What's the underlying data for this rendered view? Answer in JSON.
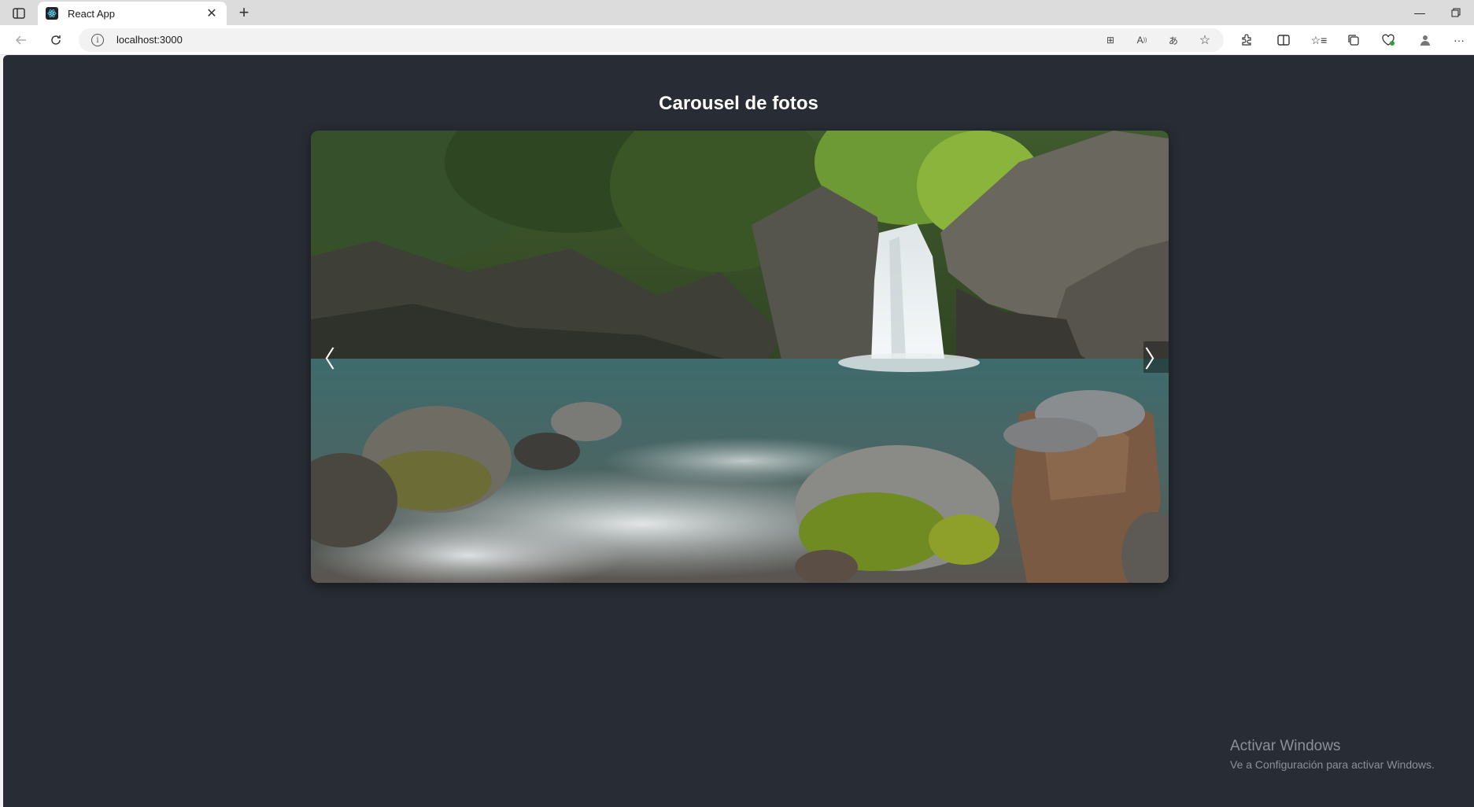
{
  "browser": {
    "tab": {
      "title": "React App"
    },
    "address": {
      "url": "localhost:3000"
    }
  },
  "page": {
    "title": "Carousel de fotos",
    "carousel": {
      "prev_label": "〈",
      "next_label": "〉"
    }
  },
  "watermark": {
    "line1": "Activar Windows",
    "line2": "Ve a Configuración para activar Windows."
  }
}
